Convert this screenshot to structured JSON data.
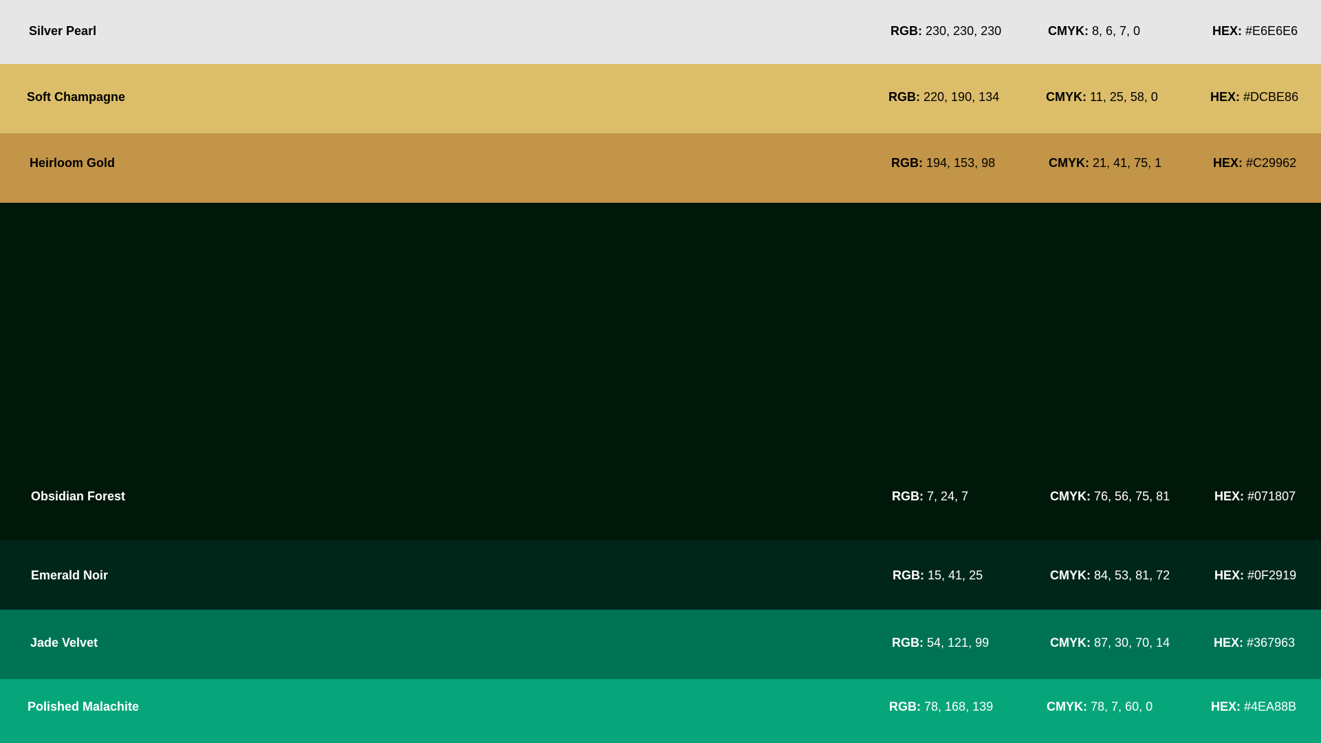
{
  "swatches": [
    {
      "name": "Silver Pearl",
      "rgb_label": "RGB:",
      "rgb": "230, 230, 230",
      "cmyk_label": "CMYK:",
      "cmyk": "8, 6, 7, 0",
      "hex_label": "HEX:",
      "hex": "#E6E6E6",
      "color": "#E6E6E6",
      "text_color": "#000000"
    },
    {
      "name": "Soft Champagne",
      "rgb_label": "RGB:",
      "rgb": "220, 190, 134",
      "cmyk_label": "CMYK:",
      "cmyk": "11, 25, 58, 0",
      "hex_label": "HEX:",
      "hex": "#DCBE86",
      "color": "#DCBE6A",
      "text_color": "#000000"
    },
    {
      "name": "Heirloom Gold",
      "rgb_label": "RGB:",
      "rgb": "194, 153, 98",
      "cmyk_label": "CMYK:",
      "cmyk": "21, 41, 75, 1",
      "hex_label": "HEX:",
      "hex": "#C29962",
      "color": "#C29548",
      "text_color": "#000000"
    },
    {
      "name": "Obsidian Forest",
      "rgb_label": "RGB:",
      "rgb": "7, 24, 7",
      "cmyk_label": "CMYK:",
      "cmyk": "76, 56, 75, 81",
      "hex_label": "HEX:",
      "hex": "#071807",
      "color": "#00180A",
      "text_color": "#FFFFFF"
    },
    {
      "name": "Emerald Noir",
      "rgb_label": "RGB:",
      "rgb": "15, 41, 25",
      "cmyk_label": "CMYK:",
      "cmyk": "84, 53, 81, 72",
      "hex_label": "HEX:",
      "hex": "#0F2919",
      "color": "#00261A",
      "text_color": "#FFFFFF"
    },
    {
      "name": "Jade Velvet",
      "rgb_label": "RGB:",
      "rgb": "54, 121, 99",
      "cmyk_label": "CMYK:",
      "cmyk": "87, 30, 70, 14",
      "hex_label": "HEX:",
      "hex": "#367963",
      "color": "#007355",
      "text_color": "#FFFFFF"
    },
    {
      "name": "Polished Malachite",
      "rgb_label": "RGB:",
      "rgb": "78, 168, 139",
      "cmyk_label": "CMYK:",
      "cmyk": "78, 7, 60, 0",
      "hex_label": "HEX:",
      "hex": "#4EA88B",
      "color": "#06A67A",
      "text_color": "#FFFFFF"
    }
  ]
}
